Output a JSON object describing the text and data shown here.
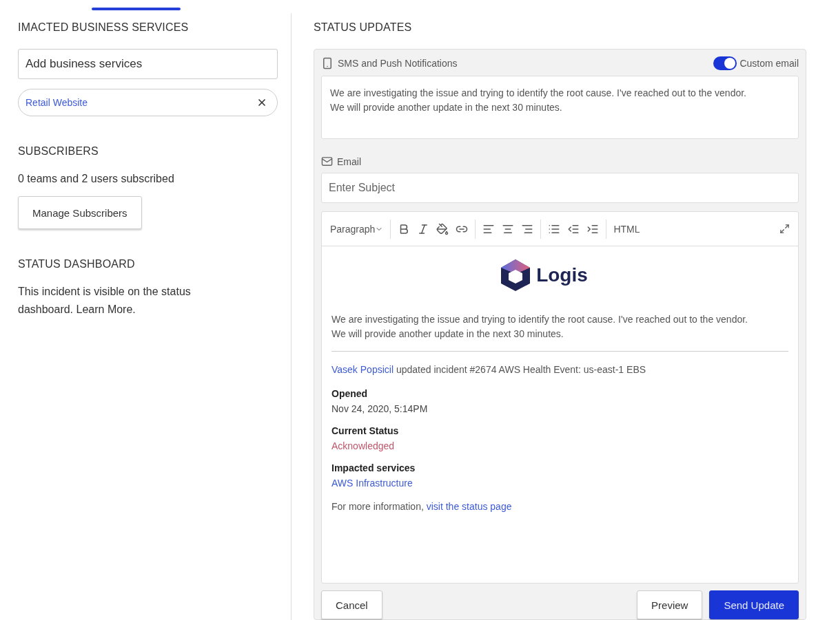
{
  "left": {
    "services": {
      "heading": "IMACTED BUSINESS SERVICES",
      "placeholder": "Add business services",
      "tags": [
        {
          "label": "Retail Website"
        }
      ]
    },
    "subscribers": {
      "heading": "SUBSCRIBERS",
      "summary": "0 teams and 2 users subscribed",
      "button": "Manage Subscribers"
    },
    "dashboard": {
      "heading": "STATUS DASHBOARD",
      "text": "This incident is visible on the status dashboard. Learn More."
    }
  },
  "status_updates": {
    "heading": "STATUS UPDATES",
    "sms": {
      "label": "SMS and Push Notifications",
      "custom_email": {
        "label": "Custom email",
        "on": true
      },
      "message": "We are investigating the issue and trying to identify the root cause. I've reached out to the vendor. We will provide another update in the next 30 minutes."
    },
    "email": {
      "label": "Email",
      "subject_placeholder": "Enter Subject",
      "toolbar": {
        "block_format": "Paragraph",
        "html": "HTML"
      },
      "body": {
        "logo": "Logis",
        "message": "We are investigating the issue and trying to identify the root cause. I've reached out to the vendor. We will provide another update in the next 30 minutes.",
        "author": "Vasek Popsicil",
        "update_text": "updated incident #2674 AWS Health Event: us-east-1 EBS",
        "fields": [
          {
            "label": "Opened",
            "value": "Nov 24, 2020, 5:14PM",
            "kind": "text"
          },
          {
            "label": "Current Status",
            "value": "Acknowledged",
            "kind": "status"
          },
          {
            "label": "Impacted services",
            "value": "AWS Infrastructure",
            "kind": "link"
          }
        ],
        "footer_text": "For more information,",
        "footer_link": "visit the status page"
      }
    },
    "buttons": {
      "cancel": "Cancel",
      "preview": "Preview",
      "send": "Send Update"
    }
  }
}
